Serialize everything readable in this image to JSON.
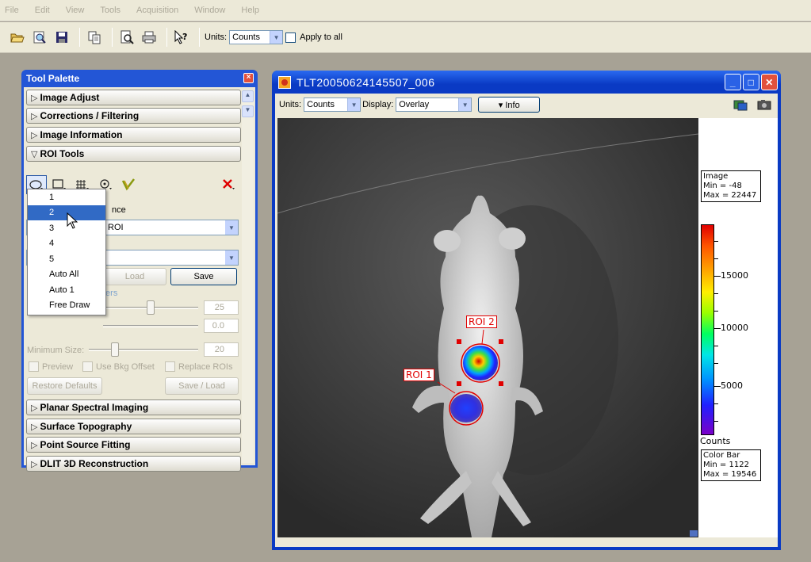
{
  "menubar": {
    "items": [
      "File",
      "Edit",
      "View",
      "Tools",
      "Acquisition",
      "Window",
      "Help"
    ]
  },
  "toolbar": {
    "units_label": "Units:",
    "units_value": "Counts",
    "apply_all_label": "Apply to all",
    "icons": [
      "open-folder-icon",
      "find-icon",
      "save-icon",
      "copy-icon",
      "print-preview-icon",
      "print-icon",
      "help-pointer-icon"
    ]
  },
  "palette": {
    "title": "Tool Palette",
    "sections": [
      "Image Adjust",
      "Corrections / Filtering",
      "Image Information",
      "ROI Tools",
      "Planar Spectral Imaging",
      "Surface Topography",
      "Point Source Fitting",
      "DLIT 3D Reconstruction"
    ],
    "roi": {
      "partial_label": "nce",
      "field1_value": "ROI",
      "load_label": "Load",
      "save_label": "Save",
      "params_partial": "ters",
      "spin1": "25",
      "spin2": "0.0",
      "min_size_label": "Minimum Size:",
      "spin3": "20",
      "preview_label": "Preview",
      "bkg_offset_label": "Use Bkg Offset",
      "replace_label": "Replace ROIs",
      "restore_label": "Restore Defaults",
      "save_load_label": "Save / Load"
    },
    "dropdown": {
      "items": [
        "1",
        "2",
        "3",
        "4",
        "5",
        "Auto All",
        "Auto 1",
        "Free Draw"
      ],
      "selected": "2"
    }
  },
  "image_window": {
    "title": "TLT20050624145507_006",
    "units_label": "Units:",
    "units_value": "Counts",
    "display_label": "Display:",
    "display_value": "Overlay",
    "info_label": "▾ Info",
    "image_box": {
      "title": "Image",
      "min": "Min = -48",
      "max": "Max = 22447"
    },
    "colorbar_box": {
      "title": "Color Bar",
      "min": "Min = 1122",
      "max": "Max = 19546"
    },
    "colorbar_ticks": [
      "15000",
      "10000",
      "5000"
    ],
    "colorbar_unit": "Counts",
    "roi_labels": [
      "ROI 1",
      "ROI 2"
    ]
  }
}
